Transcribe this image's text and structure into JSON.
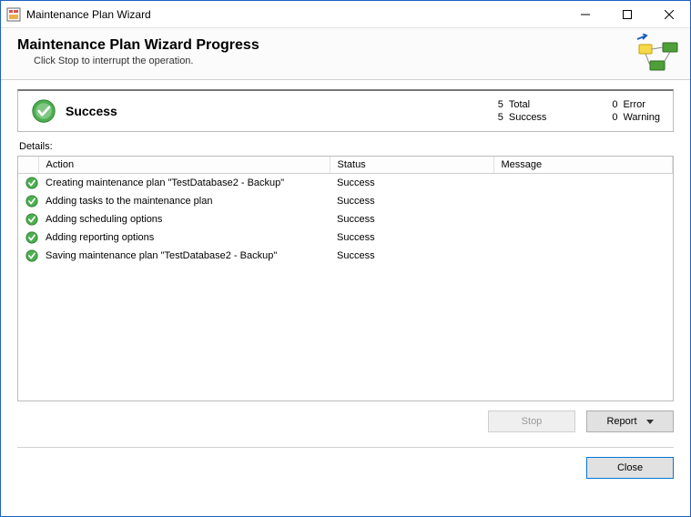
{
  "window": {
    "title": "Maintenance Plan Wizard"
  },
  "header": {
    "title": "Maintenance Plan Wizard Progress",
    "subtitle": "Click Stop to interrupt the operation."
  },
  "status": {
    "label": "Success",
    "counts": {
      "total_n": "5",
      "total_label": "Total",
      "success_n": "5",
      "success_label": "Success",
      "error_n": "0",
      "error_label": "Error",
      "warning_n": "0",
      "warning_label": "Warning"
    }
  },
  "details": {
    "label": "Details:",
    "columns": {
      "action": "Action",
      "status": "Status",
      "message": "Message"
    },
    "rows": [
      {
        "action": "Creating maintenance plan \"TestDatabase2 - Backup\"",
        "status": "Success",
        "message": ""
      },
      {
        "action": "Adding tasks to the maintenance plan",
        "status": "Success",
        "message": ""
      },
      {
        "action": "Adding scheduling options",
        "status": "Success",
        "message": ""
      },
      {
        "action": "Adding reporting options",
        "status": "Success",
        "message": ""
      },
      {
        "action": "Saving maintenance plan \"TestDatabase2 - Backup\"",
        "status": "Success",
        "message": ""
      }
    ]
  },
  "buttons": {
    "stop": "Stop",
    "report": "Report",
    "close": "Close"
  }
}
